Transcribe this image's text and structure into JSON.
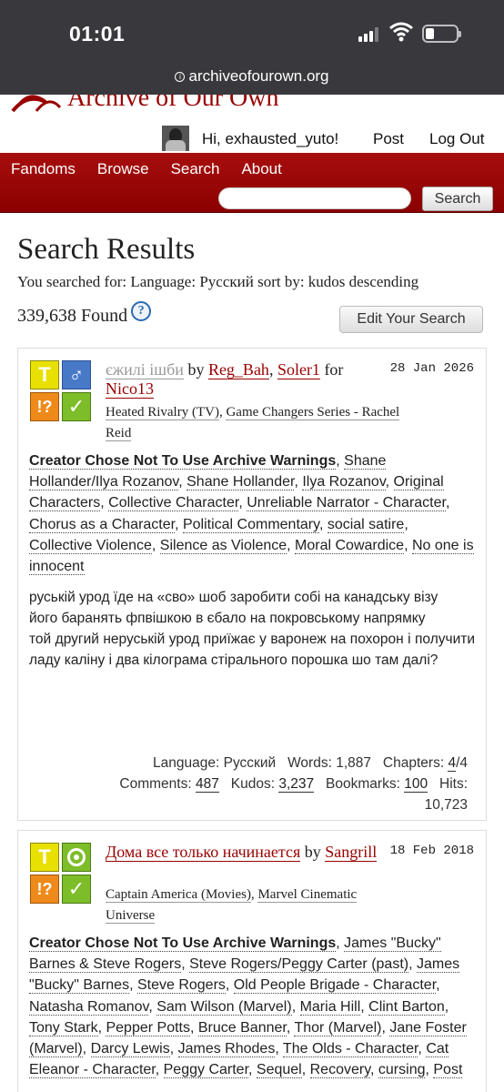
{
  "status": {
    "time": "01:01",
    "url": "archiveofourown.org"
  },
  "site": {
    "logo_text": "Archive of Our Own"
  },
  "user": {
    "greeting": "Hi, exhausted_yuto!",
    "post": "Post",
    "logout": "Log Out"
  },
  "nav": {
    "items": [
      "Fandoms",
      "Browse",
      "Search",
      "About"
    ],
    "search_button": "Search",
    "search_value": ""
  },
  "results": {
    "heading": "Search Results",
    "query": "You searched for: Language: Русский sort by: kudos descending",
    "count": "339,638 Found",
    "help": "?",
    "edit_button": "Edit Your Search"
  },
  "works": [
    {
      "title": "єжилі ішби",
      "by": "by",
      "authors": [
        "Reg_Bah",
        "Soler1"
      ],
      "for_word": "for",
      "recipient": "Nico13",
      "date": "28 Jan 2026",
      "fandoms": [
        "Heated Rivalry (TV)",
        "Game Changers Series - Rachel Reid"
      ],
      "warning": "Creator Chose Not To Use Archive Warnings",
      "tags": [
        "Shane Hollander/Ilya Rozanov",
        "Shane Hollander",
        "Ilya Rozanov",
        "Original Characters",
        "Collective Character",
        "Unreliable Narrator - Character",
        "Chorus as a Character",
        "Political Commentary",
        "social satire",
        "Collective Violence",
        "Silence as Violence",
        "Moral Cowardice",
        "No one is innocent"
      ],
      "summary": [
        "руській урод їде на «сво» шоб заробити собі на канадську візу",
        "його баранять фпвішкою в єбало на покровському напрямку",
        "той другий неруській урод приїжає у варонеж на похорон і получити ладу каліну і два кілограма стірального порошка шо там далі?"
      ],
      "stats": {
        "language_label": "Language:",
        "language": "Русский",
        "words_label": "Words:",
        "words": "1,887",
        "chapters_label": "Chapters:",
        "chapters": "4",
        "chapters_total": "/4",
        "comments_label": "Comments:",
        "comments": "487",
        "kudos_label": "Kudos:",
        "kudos": "3,237",
        "bookmarks_label": "Bookmarks:",
        "bookmarks": "100",
        "hits_label": "Hits:",
        "hits": "10,723"
      }
    },
    {
      "title": "Дома все только начинается",
      "by": "by",
      "authors": [
        "Sangrill"
      ],
      "date": "18 Feb 2018",
      "fandoms": [
        "Captain America (Movies)",
        "Marvel Cinematic Universe"
      ],
      "warning": "Creator Chose Not To Use Archive Warnings",
      "tags": [
        "James \"Bucky\" Barnes & Steve Rogers",
        "Steve Rogers/Peggy Carter (past)",
        "James \"Bucky\" Barnes",
        "Steve Rogers",
        "Old People Brigade - Character",
        "Natasha Romanov",
        "Sam Wilson (Marvel)",
        "Maria Hill",
        "Clint Barton",
        "Tony Stark",
        "Pepper Potts",
        "Bruce Banner",
        "Thor (Marvel)",
        "Jane Foster (Marvel)",
        "Darcy Lewis",
        "James Rhodes",
        "The Olds - Character",
        "Cat Eleanor - Character",
        "Peggy Carter",
        "Sequel",
        "Recovery",
        "cursing",
        "Post"
      ]
    }
  ]
}
